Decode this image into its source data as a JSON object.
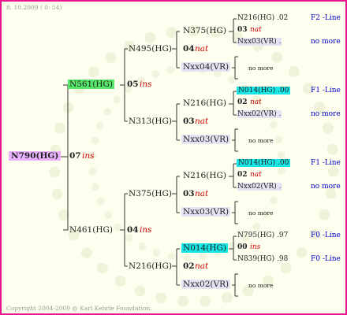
{
  "header": {
    "date": "8. 10.2009 ( 0: 54)"
  },
  "footer": {
    "copyright": "Copyright 2004-2009 @ Karl Kehrle Foundation."
  },
  "root": {
    "name": "N790(HG)",
    "gen_num": "07",
    "gen_type": "ins"
  },
  "sire": {
    "name": "N561(HG)",
    "gen_num": "05",
    "gen_type": "ins"
  },
  "dam": {
    "name": "N461(HG)",
    "gen_num": "04",
    "gen_type": "ins"
  },
  "ss": {
    "name": "N495(HG)"
  },
  "sd": {
    "name": "N313(HG)"
  },
  "ds": {
    "name": "N375(HG)"
  },
  "dd": {
    "name": "N216(HG)"
  },
  "sss": {
    "name": "N375(HG)",
    "gen_num": "04",
    "gen_type": "nat"
  },
  "ssd": {
    "name": "Nxx04(VR)"
  },
  "sds": {
    "name": "N216(HG)",
    "gen_num": "03",
    "gen_type": "nat"
  },
  "sdd": {
    "name": "Nxx03(VR)"
  },
  "dss": {
    "name": "N216(HG)",
    "gen_num": "03",
    "gen_type": "nat"
  },
  "dsd": {
    "name": "Nxx03(VR)"
  },
  "dds": {
    "name": "N014(HG)",
    "gen_num": "02",
    "gen_type": "nat"
  },
  "ddd": {
    "name": "Nxx02(VR)"
  },
  "g4": [
    {
      "sire": "N216(HG)",
      "sire_val": ".02",
      "num": "03",
      "type": "nat",
      "dam": "Nxx03(VR)",
      "dam_val": ".",
      "line1": "F2 -Line",
      "line2": "no more"
    },
    {
      "more": "no more"
    },
    {
      "sire": "N014(HG)",
      "sire_val": ".00",
      "num": "02",
      "type": "nat",
      "dam": "Nxx02(VR)",
      "dam_val": ".",
      "line1": "F1 -Line",
      "line2": "no more"
    },
    {
      "more": "no more"
    },
    {
      "sire": "N014(HG)",
      "sire_val": ".00",
      "num": "02",
      "type": "nat",
      "dam": "Nxx02(VR)",
      "dam_val": ".",
      "line1": "F1 -Line",
      "line2": "no more"
    },
    {
      "more": "no more"
    },
    {
      "sire": "N795(HG)",
      "sire_val": ".97",
      "num": "00",
      "type": "ins",
      "dam": "N839(HG)",
      "dam_val": ".98",
      "line1": "F0 -Line",
      "line2": "F0 -Line"
    },
    {
      "more": "no more"
    }
  ]
}
